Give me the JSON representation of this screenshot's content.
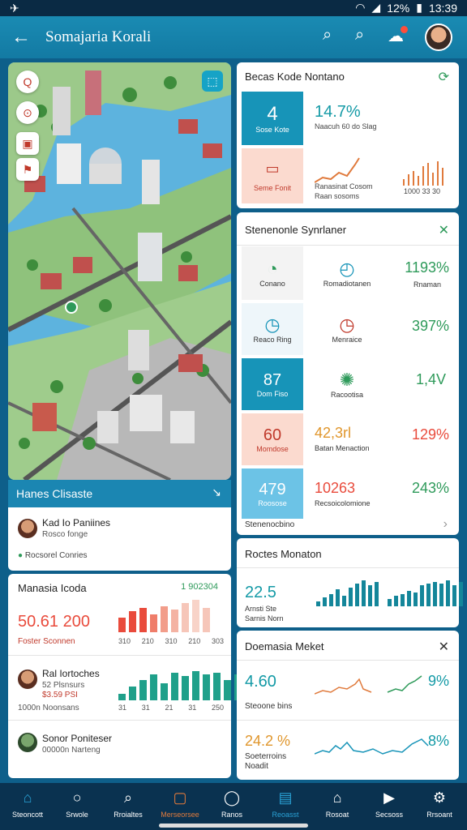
{
  "status": {
    "left": "✈",
    "battery_text": "12%",
    "time": "13:39"
  },
  "appbar": {
    "title": "Somajaria Korali"
  },
  "map": {
    "footer_label": "Hanes Clisaste",
    "pin_label": "⚑"
  },
  "person_card": {
    "name": "Kad Io Paniines",
    "sub": "Rosco fonge",
    "meta": "Rocsorel Conries"
  },
  "summary_card": {
    "title": "Manasia Icoda",
    "value_label": "1 902304",
    "big_value": "50.61 200",
    "caption": "Foster Sconnen",
    "x_ticks": [
      "310",
      "210",
      "310",
      "210",
      "303"
    ],
    "bars": [
      18,
      26,
      30,
      22,
      32,
      28,
      36,
      40,
      30
    ],
    "bar_colors": [
      "#e94b3c",
      "#e94b3c",
      "#e94b3c",
      "#ef7d6a",
      "#f29d8a",
      "#f4b3a3",
      "#f6c6b9",
      "#f8d3c8",
      "#f6c6b9"
    ]
  },
  "row2": {
    "name": "Ral Iortoches",
    "sub1": "52 Plsnsurs",
    "sub2": "$3.59 PSI",
    "sub3": "1000n Noonsans",
    "x_ticks": [
      "31",
      "31",
      "21",
      "31",
      "250"
    ],
    "bars": [
      8,
      16,
      24,
      30,
      20,
      32,
      28,
      34,
      30,
      32,
      24,
      30
    ]
  },
  "row3": {
    "name": "Sonor Poniteser",
    "sub": "00000n Narteng"
  },
  "panel1": {
    "title": "Becas Kode Nontano",
    "tile1_num": "4",
    "tile1_label": "Sose Kote",
    "metric": "14.7%",
    "metric_sub": "Naacuh 60 do Slag",
    "tile2_label": "Seme Fonit",
    "spark_sub1": "Ranasinat Cosom",
    "spark_sub2": "Raan sosoms",
    "spark_ticks": "1000 33 30"
  },
  "panel2": {
    "title": "Stenenonle Synrlaner",
    "r1": [
      "Conano",
      "Romadiotanen",
      "1193%",
      "Rnaman"
    ],
    "r2": [
      "Reaco Ring",
      "Menraice",
      "397%"
    ],
    "r3": [
      "87",
      "Dom Fiso",
      "Racootisa",
      "1,4V"
    ],
    "r4": [
      "60",
      "Momdose",
      "42,3rl",
      "Batan Menaction",
      "129%"
    ],
    "r5": [
      "479",
      "Roosose",
      "10263",
      "Recsoicolomione",
      "243%"
    ],
    "footer": "Stenenocbino"
  },
  "panel3": {
    "title": "Roctes Monaton",
    "value": "22.5",
    "sub1": "Arnsti Ste",
    "sub2": "Sarnis Norn",
    "bars1": [
      6,
      10,
      14,
      20,
      12,
      22,
      26,
      30,
      24,
      28
    ],
    "bars2": [
      8,
      12,
      14,
      18,
      16,
      24,
      26,
      28,
      26,
      30,
      24,
      28
    ]
  },
  "panel4": {
    "title": "Doemasia Meket",
    "v1": "4.60",
    "v1sub": "Steoone bins",
    "p1": "9%",
    "v2": "24.2 %",
    "v2sub1": "Soeterroins",
    "v2sub2": "Noadit",
    "p2": "8%"
  },
  "nav": [
    "Steoncott",
    "Srwole",
    "Rroialtes",
    "Merseorsee",
    "Ranos",
    "Reoasst",
    "Rosoat",
    "Secsoss",
    "Rrsoant"
  ],
  "colors": {
    "accent": "#1a8bb3",
    "teal": "#149aa6",
    "red": "#e94b3c",
    "green": "#2e9a5a"
  }
}
